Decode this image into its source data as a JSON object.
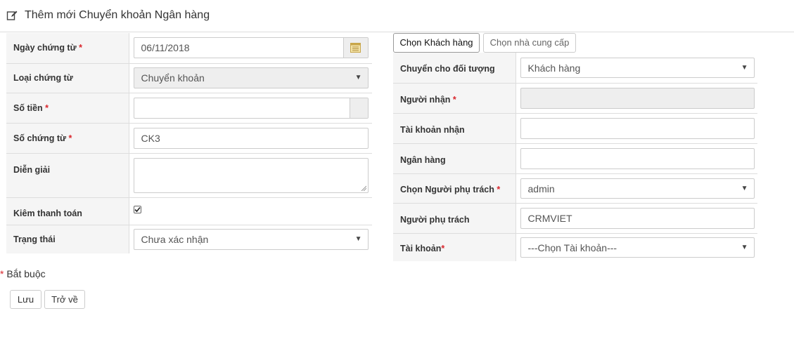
{
  "header": {
    "title": "Thêm mới Chuyển khoản Ngân hàng",
    "icon": "edit-icon"
  },
  "left_form": {
    "ngay_chung_tu": {
      "label": "Ngày chứng từ",
      "required": "*",
      "value": "06/11/2018"
    },
    "loai_chung_tu": {
      "label": "Loại chứng từ",
      "value": "Chuyển khoản"
    },
    "so_tien": {
      "label": "Số tiền",
      "required": "*",
      "value": ""
    },
    "so_chung_tu": {
      "label": "Số chứng từ",
      "required": "*",
      "value": "CK3"
    },
    "dien_giai": {
      "label": "Diễn giải",
      "value": ""
    },
    "kiem_thanh_toan": {
      "label": "Kiêm thanh toán",
      "checked": true
    },
    "trang_thai": {
      "label": "Trạng thái",
      "value": "Chưa xác nhận"
    }
  },
  "tabs": {
    "khach_hang": "Chọn Khách hàng",
    "nha_cung_cap": "Chọn nhà cung cấp"
  },
  "right_form": {
    "chuyen_cho": {
      "label": "Chuyển cho đối tượng",
      "value": "Khách hàng"
    },
    "nguoi_nhan": {
      "label": "Người nhận",
      "required": "*",
      "value": ""
    },
    "tai_khoan_nhan": {
      "label": "Tài khoản nhận",
      "value": ""
    },
    "ngan_hang": {
      "label": "Ngân hàng",
      "value": ""
    },
    "chon_nguoi_phu_trach": {
      "label": "Chọn Người phụ trách",
      "required": "*",
      "value": "admin"
    },
    "nguoi_phu_trach": {
      "label": "Người phụ trách",
      "value": "CRMVIET"
    },
    "tai_khoan": {
      "label": "Tài khoản",
      "required": "*",
      "value": "---Chọn Tài khoản---"
    }
  },
  "footer": {
    "required_mark": "*",
    "required_note": "Bắt buộc",
    "save_label": "Lưu",
    "back_label": "Trở về"
  },
  "colors": {
    "required": "#d9262c",
    "label_bg": "#f5f5f5",
    "border": "#dddddd",
    "disabled_bg": "#eeeeee"
  }
}
